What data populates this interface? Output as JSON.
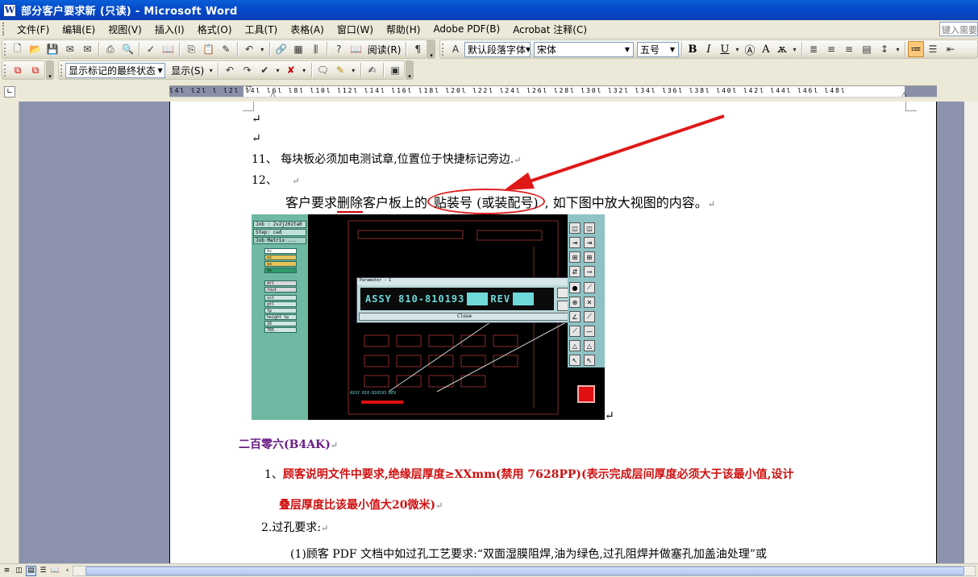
{
  "window": {
    "title": "部分客户要求新 (只读) - Microsoft Word"
  },
  "menu": {
    "items": [
      "文件(F)",
      "编辑(E)",
      "视图(V)",
      "插入(I)",
      "格式(O)",
      "工具(T)",
      "表格(A)",
      "窗口(W)",
      "帮助(H)",
      "Adobe PDF(B)",
      "Acrobat 注释(C)"
    ],
    "help_box": "键入需要"
  },
  "standard_toolbar": {
    "read_label": "阅读(R)"
  },
  "formatting_toolbar": {
    "style_value": "默认段落字体",
    "font_value": "宋体",
    "size_value": "五号",
    "bold": "B",
    "italic": "I",
    "underline": "U"
  },
  "reviewing_toolbar": {
    "display_state": "显示标记的最终状态",
    "show_label": "显示(S)"
  },
  "ruler": {
    "numbers": "l4l l2l l l2l l4l l6l l8l l10l l12l l14l l16l l18l l20l l22l l24l l26l l28l l30l l32l l34l l36l l38l l40l l42l l44l l46l l48l"
  },
  "document": {
    "item11": "11、  每块板必须加电测试章,位置位于快捷标记旁边.",
    "item12": "12、",
    "req_prefix": "客户要求",
    "req_delete": "删除",
    "req_mid": "客户板上的",
    "req_circled": "贴装号 (或装配号)",
    "req_suffix": ", 如下图中放大视图的内容。",
    "para_mark": "↵",
    "heading": "二百零六(B4AK)",
    "b1_num": "1、",
    "b1_text_line1": "顾客说明文件中要求,绝缘层厚度≥XXmm(禁用 7628PP)(表示完成层间厚度必须大于该最小值,设计",
    "b1_text_line2": "叠层厚度比该最小值大20微米)",
    "b2": "2.过孔要求:",
    "b2_sub": "(1)顾客 PDF 文档中如过孔工艺要求:“双面湿膜阻焊,油为绿色,过孔阻焊并做塞孔加盖油处理”或"
  },
  "cam_image": {
    "job_label": "Job : 2v2j202ta0",
    "step_label": "Step: cad",
    "matrix_label": "Job Matrix ...",
    "layers": [
      "tc",
      "cc",
      "ss",
      "ts",
      "drl",
      "rout",
      "sst",
      "gtl",
      "tp",
      "height_tp",
      "16",
      "765"
    ],
    "popup_title": "Paramater - 1",
    "popup_text": "ASSY 810-810193",
    "popup_rev": "REV",
    "popup_close": "Close",
    "callout_label": "ASSY 810-810193 REV"
  },
  "colors": {
    "accent_red": "#d01010",
    "heading_purple": "#6a1e86",
    "cam_panel": "#6fb8a3",
    "cam_text": "#6fd9d9"
  }
}
